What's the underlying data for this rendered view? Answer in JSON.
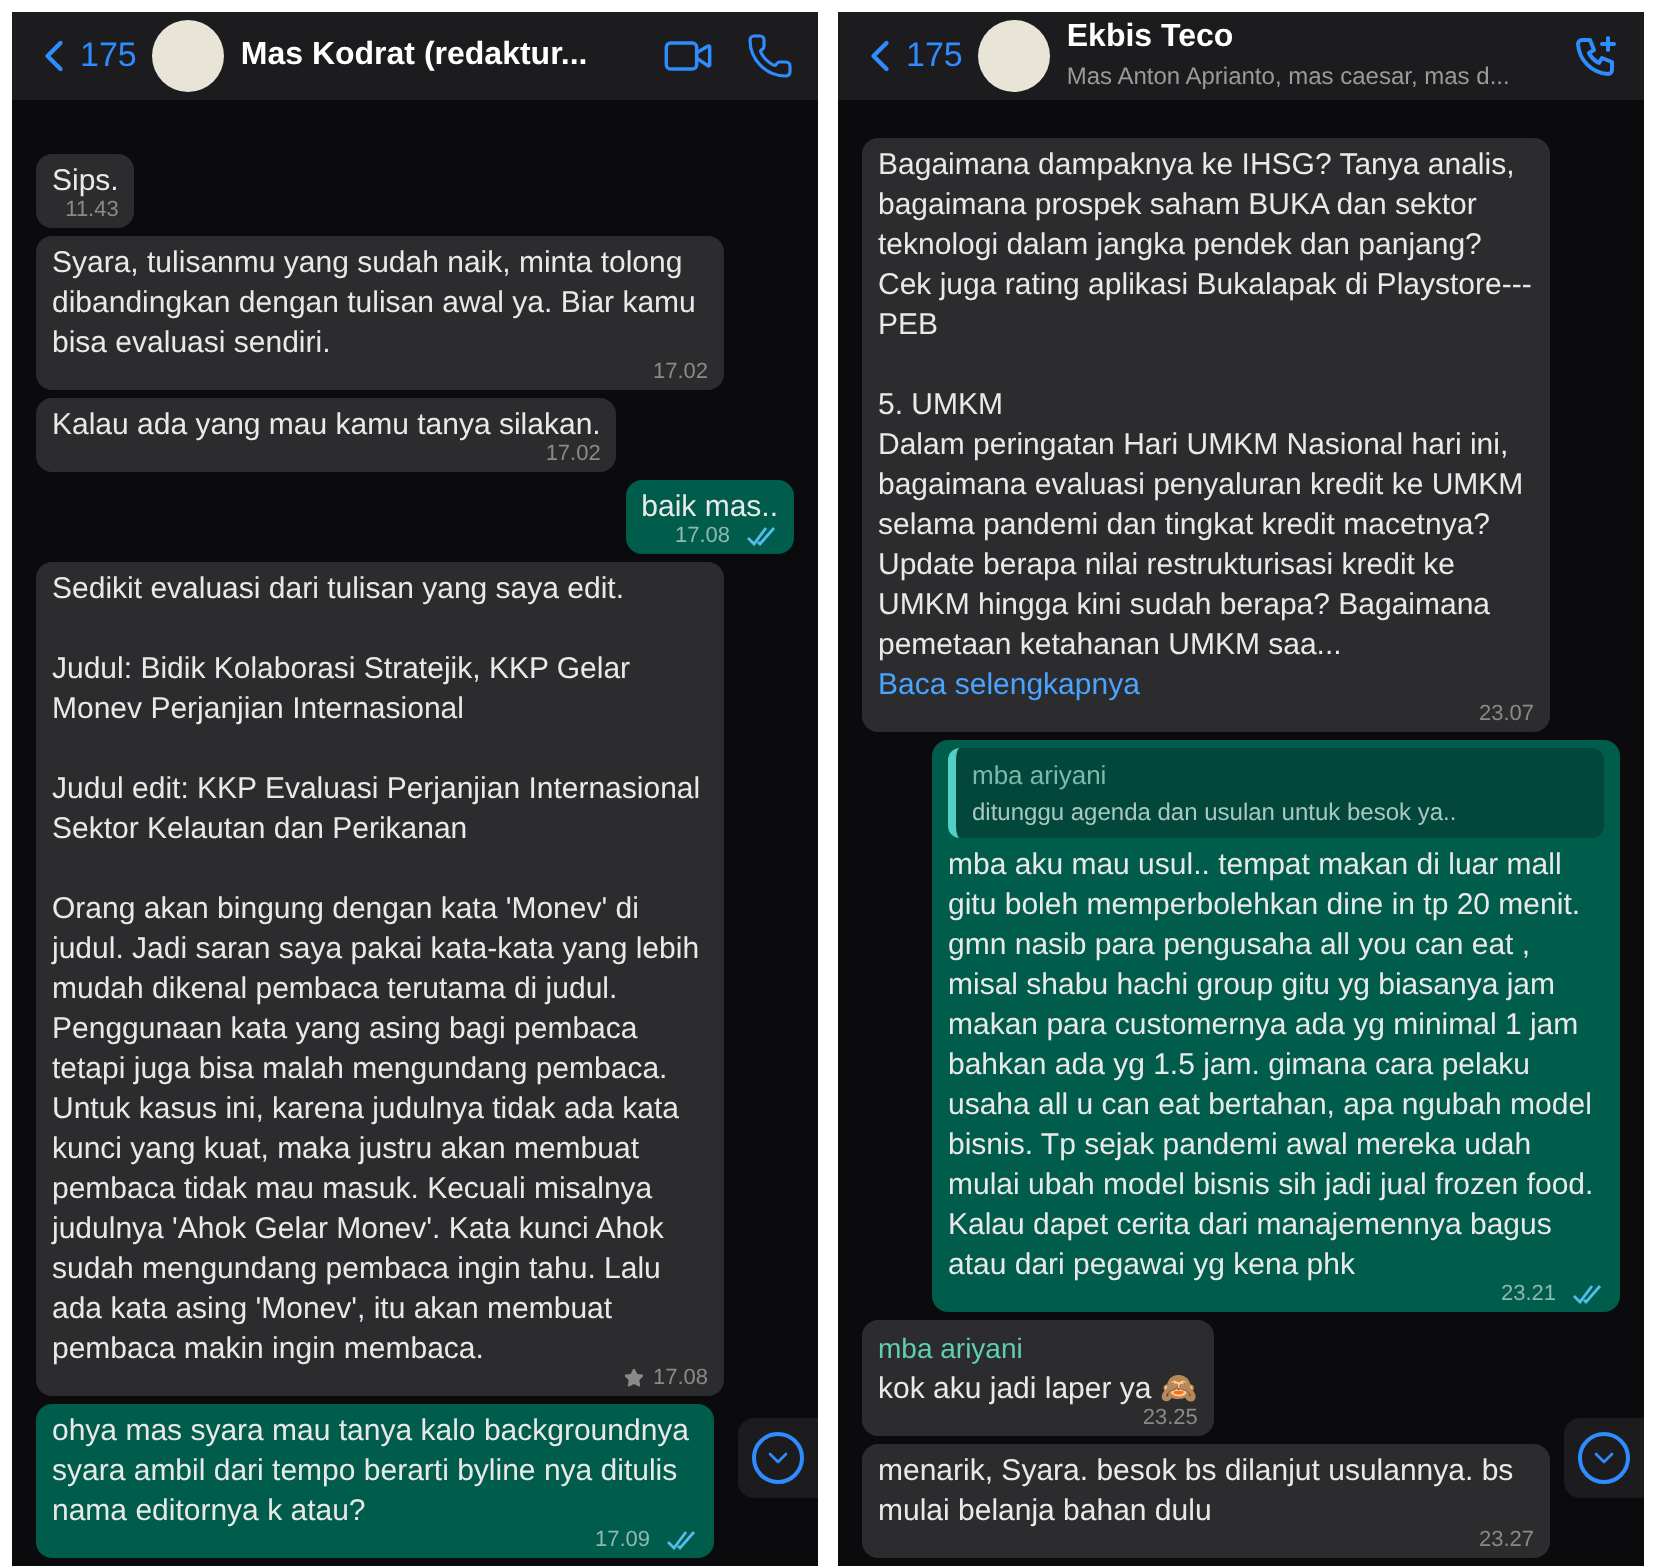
{
  "chats": [
    {
      "kind": "direct",
      "back_count": "175",
      "title": "Mas Kodrat (redaktur...",
      "messages": [
        {
          "kind": "in",
          "text": "Sips.",
          "time": "11.43",
          "starred": false
        },
        {
          "kind": "in",
          "text": "Syara, tulisanmu yang sudah naik, minta tolong dibandingkan dengan tulisan awal ya. Biar kamu bisa evaluasi sendiri.",
          "time": "17.02",
          "starred": false
        },
        {
          "kind": "in",
          "text": "Kalau ada yang mau kamu tanya silakan.",
          "time": "17.02",
          "starred": false
        },
        {
          "kind": "out",
          "text": "baik mas..",
          "time": "17.08",
          "read": true
        },
        {
          "kind": "in",
          "text": "Sedikit evaluasi dari tulisan yang saya edit.\n\nJudul: Bidik Kolaborasi Stratejik, KKP Gelar Monev Perjanjian Internasional\n\nJudul edit: KKP Evaluasi Perjanjian Internasional Sektor Kelautan dan Perikanan\n\nOrang akan bingung dengan kata 'Monev' di judul. Jadi saran saya pakai kata-kata yang lebih mudah dikenal pembaca terutama di judul. Penggunaan kata yang asing bagi pembaca tetapi juga bisa malah mengundang pembaca. Untuk kasus ini, karena judulnya tidak ada kata kunci yang kuat, maka justru akan membuat pembaca tidak mau masuk. Kecuali misalnya judulnya 'Ahok Gelar Monev'. Kata kunci Ahok sudah mengundang pembaca ingin tahu. Lalu ada kata asing 'Monev', itu akan membuat pembaca makin ingin membaca.",
          "time": "17.08",
          "starred": true
        },
        {
          "kind": "out",
          "text": "ohya mas syara mau tanya kalo backgroundnya syara ambil dari tempo berarti byline nya ditulis nama editornya k atau?",
          "time": "17.09",
          "read": true
        }
      ]
    },
    {
      "kind": "group",
      "back_count": "175",
      "title": "Ekbis Teco",
      "subtitle": "Mas Anton Aprianto, mas caesar, mas d...",
      "messages": [
        {
          "kind": "in",
          "text": "Bagaimana dampaknya ke IHSG? Tanya analis, bagaimana prospek saham BUKA dan sektor teknologi dalam jangka pendek dan panjang? Cek juga rating aplikasi Bukalapak di Playstore--- PEB\n\n5. UMKM\nDalam peringatan Hari UMKM Nasional hari ini, bagaimana evaluasi penyaluran kredit ke UMKM selama pandemi dan tingkat kredit macetnya? Update berapa nilai restrukturisasi kredit ke UMKM hingga kini sudah berapa? Bagaimana pemetaan ketahanan UMKM saa...",
          "more": "Baca selengkapnya",
          "time": "23.07",
          "starred": false
        },
        {
          "kind": "out",
          "quote": {
            "sender": "mba ariyani",
            "text": "ditunggu agenda dan usulan untuk besok ya.."
          },
          "text": "mba aku mau usul.. tempat makan di luar mall gitu boleh memperbolehkan dine in tp 20 menit. gmn nasib para pengusaha all you can eat , misal shabu hachi group gitu yg biasanya jam makan para customernya ada yg minimal 1 jam bahkan ada yg 1.5 jam. gimana cara pelaku usaha all u can eat bertahan, apa ngubah model bisnis. Tp sejak pandemi awal mereka udah mulai ubah model bisnis sih jadi jual frozen food. Kalau dapet cerita dari manajemennya bagus atau dari pegawai yg kena phk",
          "time": "23.21",
          "read": true
        },
        {
          "kind": "in",
          "sender": "mba ariyani",
          "text": "kok aku jadi laper ya 🙈",
          "time": "23.25",
          "starred": false
        },
        {
          "kind": "in",
          "text": "menarik, Syara. besok bs dilanjut usulannya. bs mulai belanja bahan dulu",
          "time": "23.27",
          "starred": false
        }
      ]
    }
  ]
}
